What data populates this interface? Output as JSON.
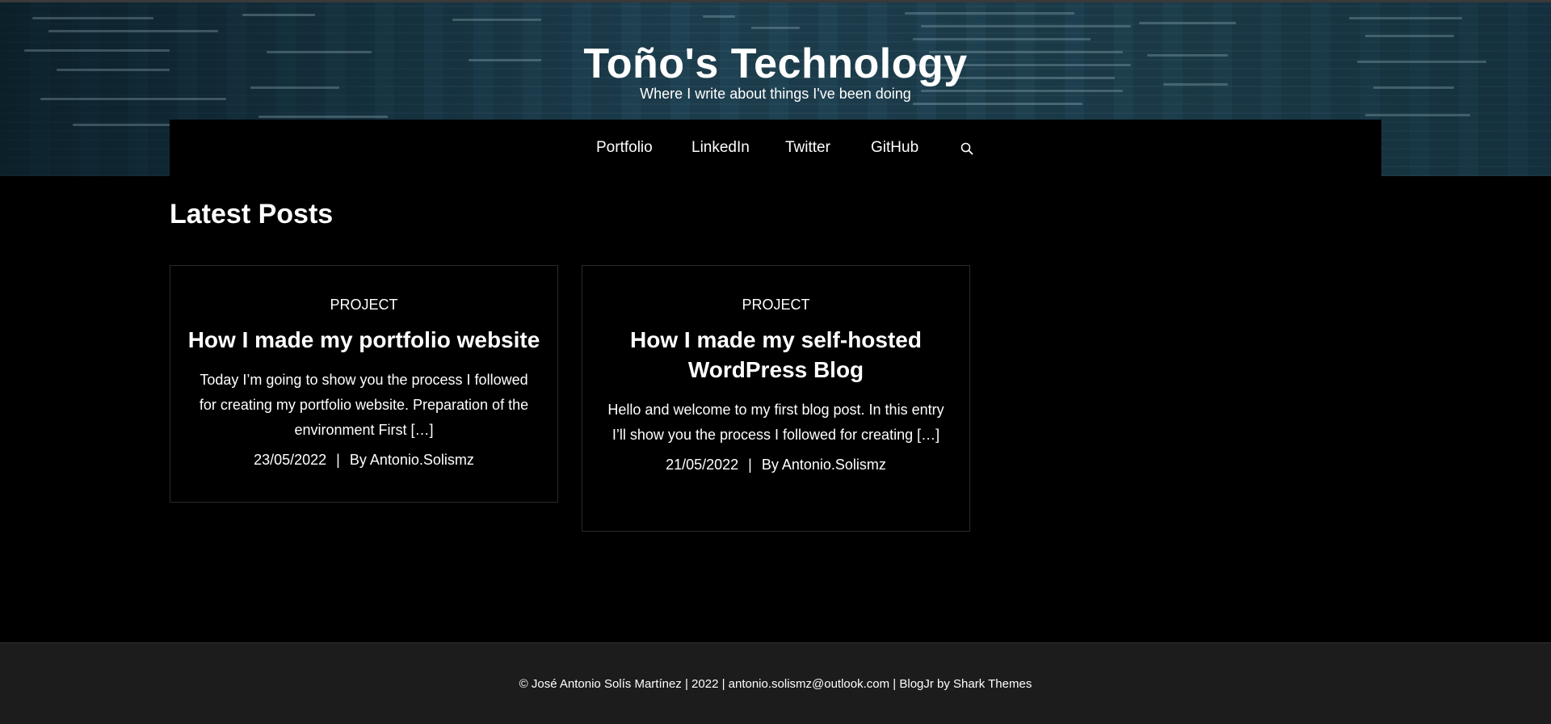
{
  "header": {
    "site_title": "Toño's Technology",
    "tagline": "Where I write about things I've been doing"
  },
  "nav": {
    "items": [
      {
        "label": "Portfolio"
      },
      {
        "label": "LinkedIn"
      },
      {
        "label": "Twitter"
      },
      {
        "label": "GitHub"
      }
    ],
    "search_icon": "search-icon"
  },
  "main": {
    "heading": "Latest Posts",
    "posts": [
      {
        "category": "PROJECT",
        "title": "How I made my portfolio website",
        "excerpt": "Today I’m going to show you the process I followed for creating my portfolio website. Preparation of the environment First […]",
        "date": "23/05/2022",
        "separator": "|",
        "author": "By Antonio.Solismz"
      },
      {
        "category": "PROJECT",
        "title": "How I made my self-hosted WordPress Blog",
        "excerpt": "Hello and welcome to my first blog post. In this entry I’ll show you the process I followed for creating […]",
        "date": "21/05/2022",
        "separator": "|",
        "author": "By Antonio.Solismz"
      }
    ]
  },
  "footer": {
    "text": "© José Antonio Solís Martínez | 2022 | antonio.solismz@outlook.com | BlogJr by Shark Themes"
  },
  "colors": {
    "page_bg": "#000000",
    "footer_bg": "#1c1c1c",
    "hero_tint": "#1b3846",
    "text": "#ffffff"
  }
}
